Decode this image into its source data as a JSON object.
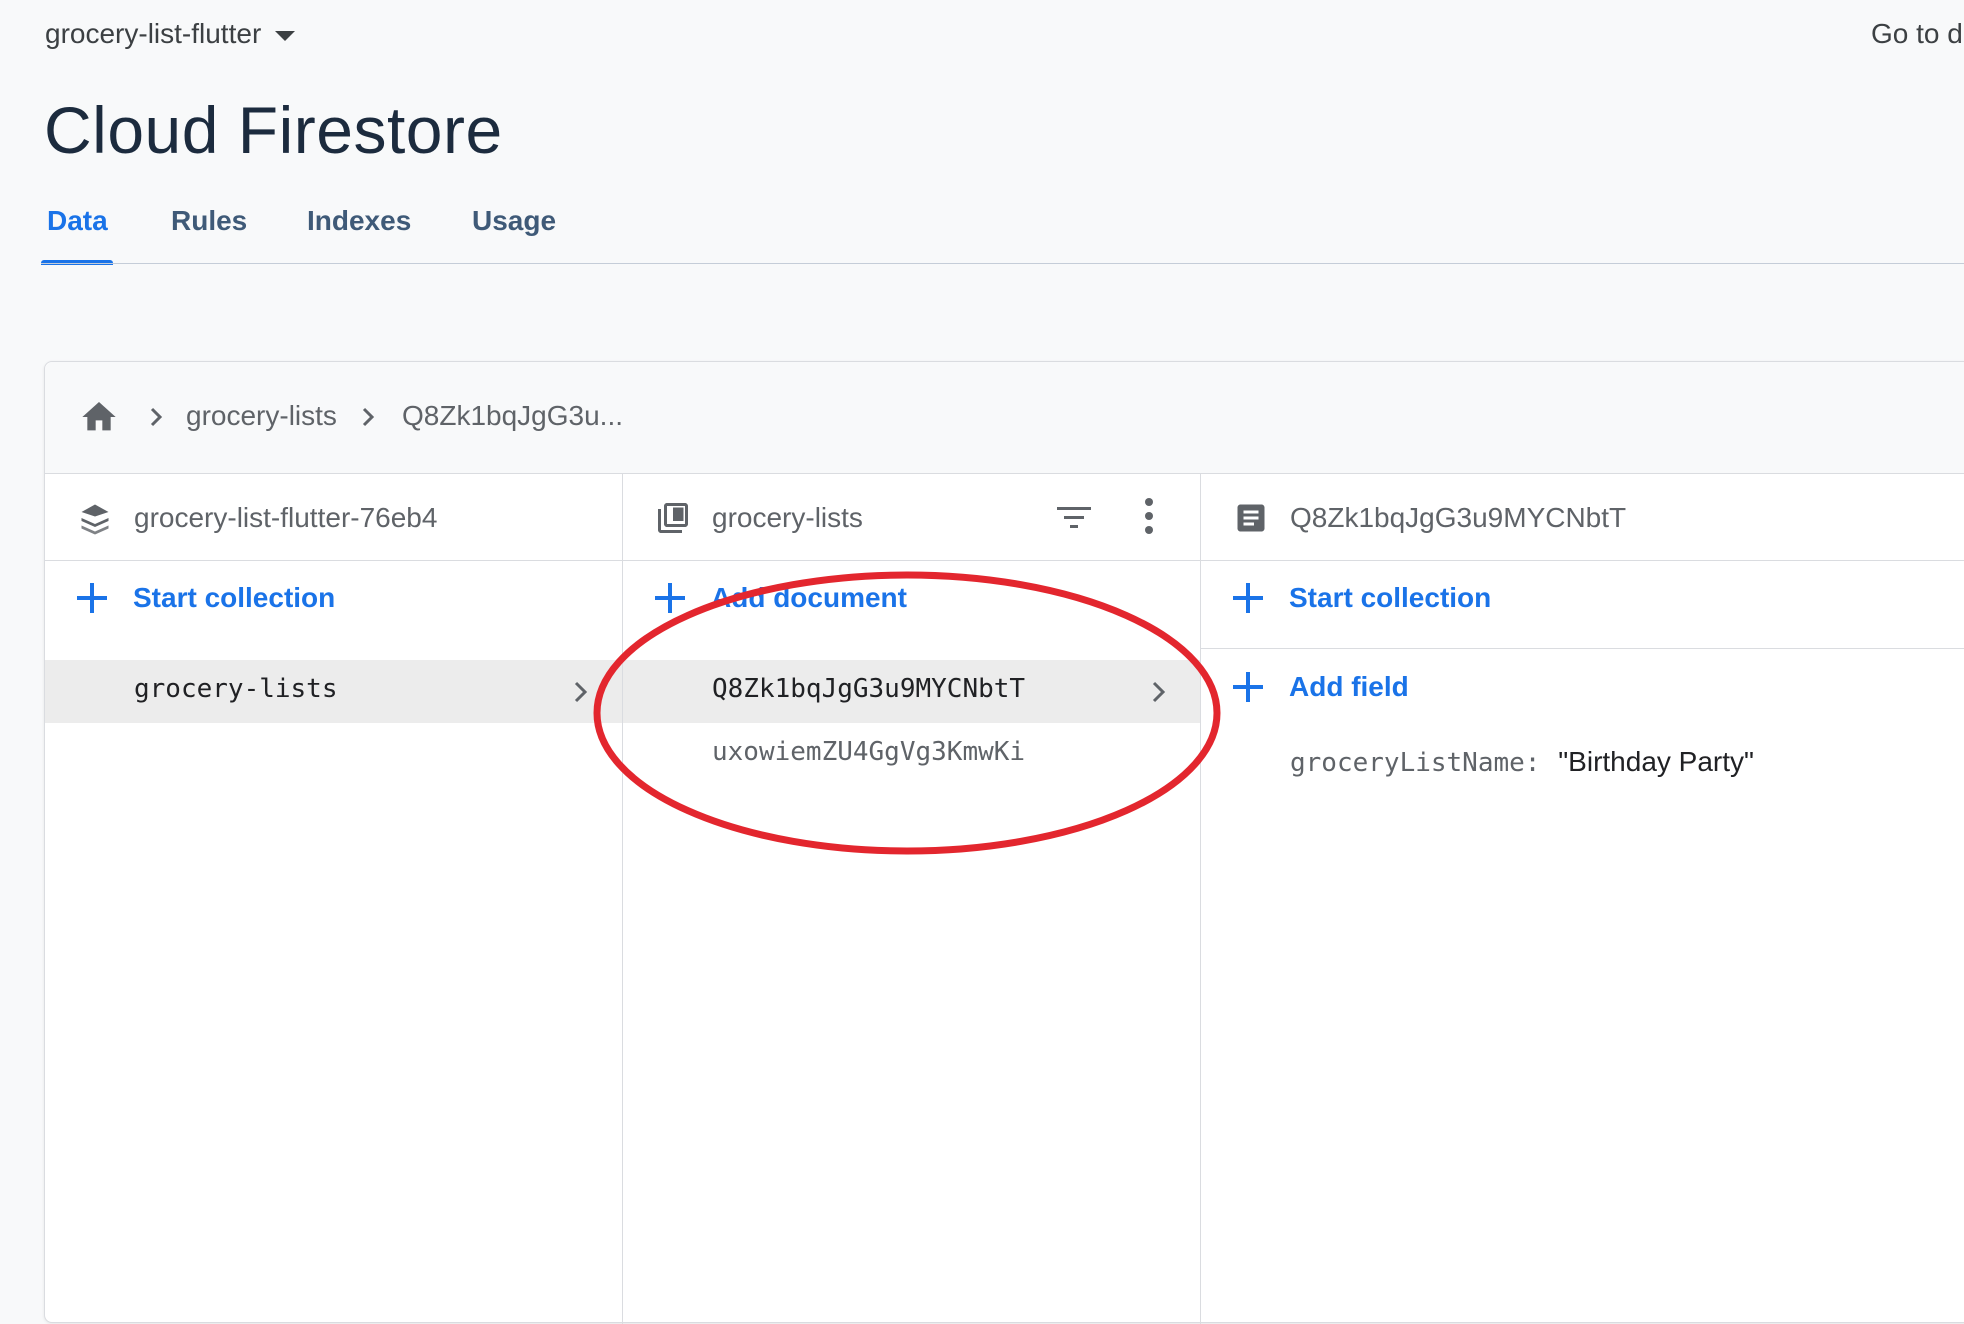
{
  "header": {
    "project_name": "grocery-list-flutter",
    "goto_link": "Go to d",
    "page_title": "Cloud Firestore"
  },
  "tabs": [
    {
      "label": "Data",
      "active": true
    },
    {
      "label": "Rules",
      "active": false
    },
    {
      "label": "Indexes",
      "active": false
    },
    {
      "label": "Usage",
      "active": false
    }
  ],
  "breadcrumb": {
    "items": [
      "grocery-lists",
      "Q8Zk1bqJgG3u..."
    ]
  },
  "columns": {
    "root": {
      "title": "grocery-list-flutter-76eb4",
      "action": "Start collection",
      "items": [
        {
          "label": "grocery-lists",
          "selected": true
        }
      ]
    },
    "collection": {
      "title": "grocery-lists",
      "action": "Add document",
      "items": [
        {
          "label": "Q8Zk1bqJgG3u9MYCNbtT",
          "selected": true
        },
        {
          "label": "uxowiemZU4GgVg3KmwKi",
          "selected": false
        }
      ]
    },
    "document": {
      "title": "Q8Zk1bqJgG3u9MYCNbtT",
      "action_collection": "Start collection",
      "action_field": "Add field",
      "fields": [
        {
          "key": "groceryListName:",
          "value": "\"Birthday Party\""
        }
      ]
    }
  },
  "colors": {
    "accent": "#1a73e8",
    "annotation": "#e3262e"
  }
}
